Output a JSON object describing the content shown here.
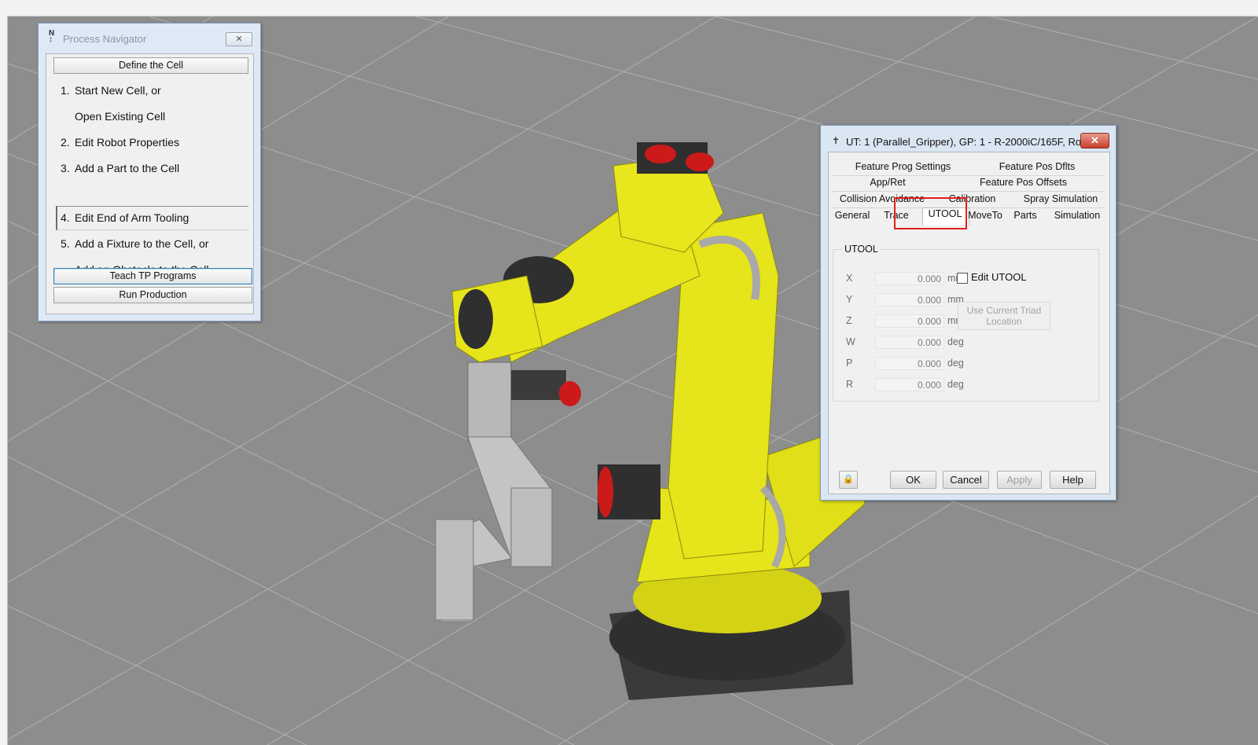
{
  "process_navigator": {
    "title": "Process Navigator",
    "icon": "navigator-icon",
    "close_icon": "close-icon",
    "header": "Define the Cell",
    "steps": [
      {
        "num": "1.",
        "label": "Start New Cell, or"
      },
      {
        "num": "",
        "label": "Open Existing Cell"
      },
      {
        "num": "2.",
        "label": "Edit Robot Properties"
      },
      {
        "num": "3.",
        "label": "Add a Part to the Cell"
      },
      {
        "num": "4.",
        "label": "Edit End of Arm Tooling"
      },
      {
        "num": "5.",
        "label": "Add a Fixture to the Cell, or"
      },
      {
        "num": "",
        "label": "Add an Obstacle to the Cell"
      }
    ],
    "teach_button": "Teach TP Programs",
    "run_button": "Run Production"
  },
  "dialog": {
    "title": "UT: 1  (Parallel_Gripper), GP: 1 - R-2000iC/165F, Ro...",
    "pin_icon": "pin-icon",
    "close_icon": "close-icon",
    "tabs": {
      "feature_prog_settings": "Feature Prog Settings",
      "feature_pos_dflts": "Feature Pos Dflts",
      "app_ret": "App/Ret",
      "feature_pos_offsets": "Feature Pos Offsets",
      "collision_avoidance": "Collision Avoidance",
      "calibration": "Calibration",
      "spray_simulation": "Spray Simulation",
      "general": "General",
      "trace": "Trace",
      "utool": "UTOOL",
      "moveto": "MoveTo",
      "parts": "Parts",
      "simulation": "Simulation"
    },
    "active_tab": "UTOOL",
    "group_label": "UTOOL",
    "fields": [
      {
        "label": "X",
        "value": "0.000",
        "unit": "mm"
      },
      {
        "label": "Y",
        "value": "0.000",
        "unit": "mm"
      },
      {
        "label": "Z",
        "value": "0.000",
        "unit": "mm"
      },
      {
        "label": "W",
        "value": "0.000",
        "unit": "deg"
      },
      {
        "label": "P",
        "value": "0.000",
        "unit": "deg"
      },
      {
        "label": "R",
        "value": "0.000",
        "unit": "deg"
      }
    ],
    "edit_utool_label": "Edit UTOOL",
    "edit_utool_checked": false,
    "use_triad_line1": "Use Current Triad",
    "use_triad_line2": "Location",
    "buttons": {
      "ok": "OK",
      "cancel": "Cancel",
      "apply": "Apply",
      "help": "Help"
    },
    "lock_icon": "lock-icon"
  },
  "colors": {
    "robot_yellow": "#e6e41a",
    "highlight_red": "#e0201a",
    "floor_gray": "#8d8d8d"
  }
}
